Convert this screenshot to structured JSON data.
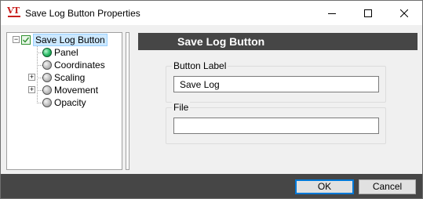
{
  "window": {
    "title": "Save Log Button Properties",
    "app_icon_text": "VT"
  },
  "tree": {
    "root_label": "Save Log Button",
    "items": [
      {
        "label": "Panel",
        "status": "green",
        "expandable": false
      },
      {
        "label": "Coordinates",
        "status": "gray",
        "expandable": false
      },
      {
        "label": "Scaling",
        "status": "gray",
        "expandable": true
      },
      {
        "label": "Movement",
        "status": "gray",
        "expandable": true
      },
      {
        "label": "Opacity",
        "status": "gray",
        "expandable": false
      }
    ]
  },
  "panel": {
    "header_title": "Save Log Button",
    "button_label_group": {
      "label": "Button Label",
      "value": "Save Log"
    },
    "file_group": {
      "label": "File",
      "value": ""
    }
  },
  "buttons": {
    "ok": "OK",
    "cancel": "Cancel"
  },
  "colors": {
    "header_bg": "#464646",
    "selection_bg": "#cce8ff",
    "ok_border": "#0078d7"
  }
}
